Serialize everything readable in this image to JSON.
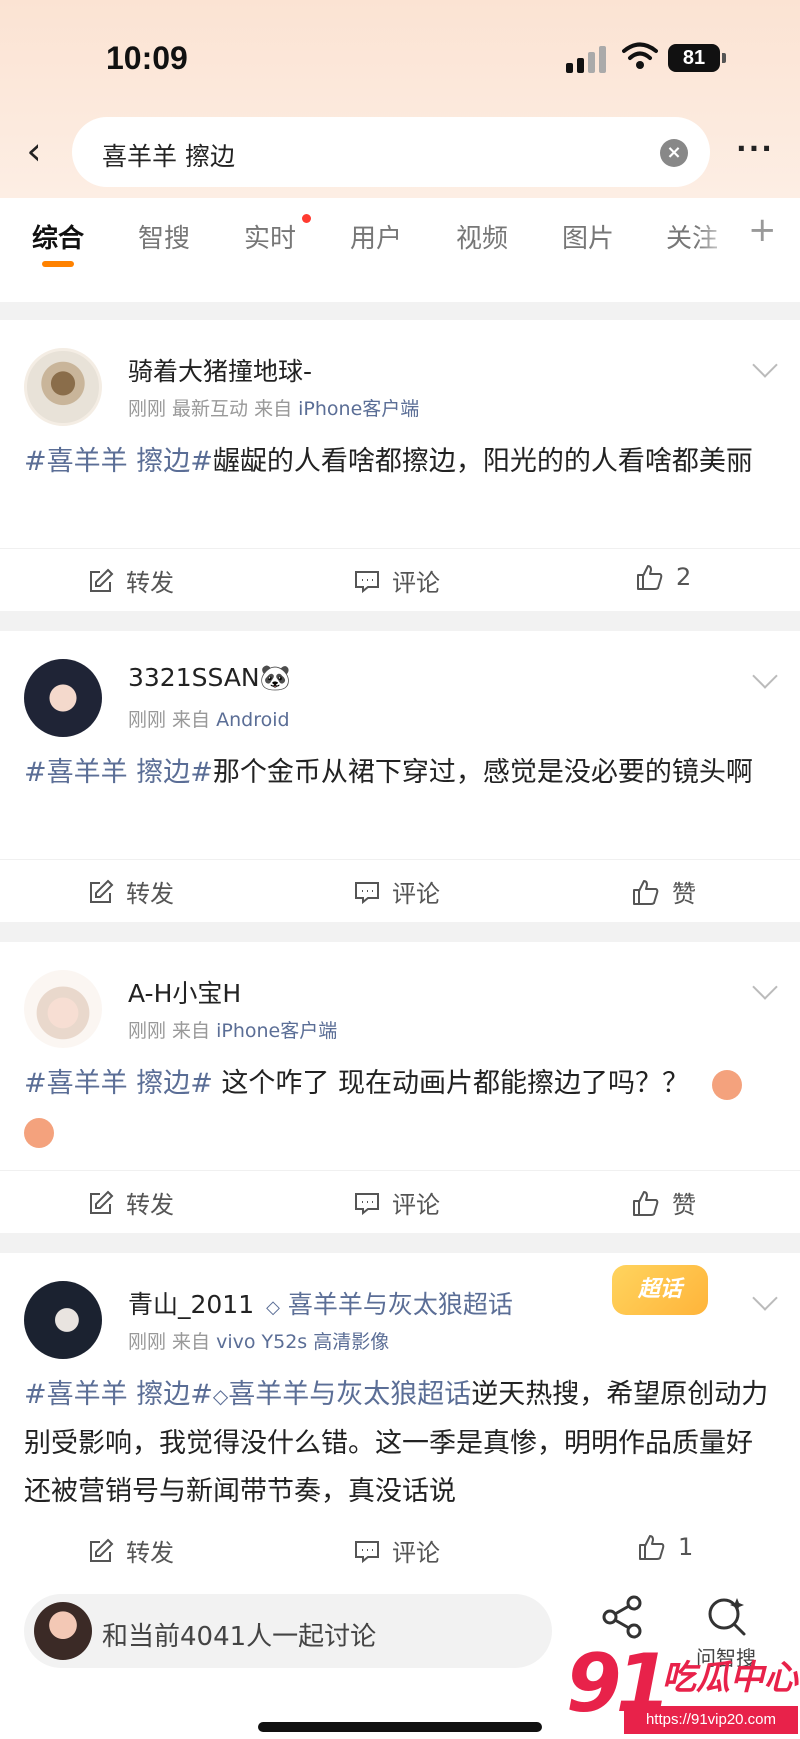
{
  "status": {
    "time": "10:09",
    "battery": "81"
  },
  "search": {
    "query": "喜羊羊 擦边"
  },
  "tabs": [
    "综合",
    "智搜",
    "实时",
    "用户",
    "视频",
    "图片",
    "关注"
  ],
  "actions": {
    "repost": "转发",
    "comment": "评论",
    "like": "赞"
  },
  "posts": [
    {
      "user": "骑着大猪撞地球-",
      "meta_prefix": "刚刚 最新互动  来自",
      "source": "iPhone客户端",
      "tag": "#喜羊羊 擦边#",
      "text": "龌龊的人看啥都擦边，阳光的的人看啥都美丽",
      "likes": "2"
    },
    {
      "user": "3321SSAN🐼",
      "meta_prefix": "刚刚  来自",
      "source": "Android",
      "tag": "#喜羊羊 擦边#",
      "text": "那个金币从裙下穿过，感觉是没必要的镜头啊",
      "likes": "赞"
    },
    {
      "user": "A-H小宝H",
      "meta_prefix": "刚刚  来自",
      "source": "iPhone客户端",
      "tag": "#喜羊羊 擦边#",
      "text": " 这个咋了 现在动画片都能擦边了吗？？",
      "likes": "赞"
    },
    {
      "user": "青山_2011",
      "supertopic": "喜羊羊与灰太狼超话",
      "meta_prefix": "刚刚  来自",
      "source": "vivo Y52s 高清影像",
      "tag": "#喜羊羊 擦边#",
      "tag2": "喜羊羊与灰太狼超话",
      "text": "逆天热搜，希望原创动力别受影响，我觉得没什么错。这一季是真惨，明明作品质量好还被营销号与新闻带节奏，真没话说",
      "likes": "1",
      "badge": "超话"
    }
  ],
  "bottom": {
    "discuss": "和当前4041人一起讨论",
    "ask": "问智搜"
  },
  "watermark": {
    "brand": "91",
    "brand_cn": "吃瓜中心",
    "url": "https://91vip20.com"
  }
}
